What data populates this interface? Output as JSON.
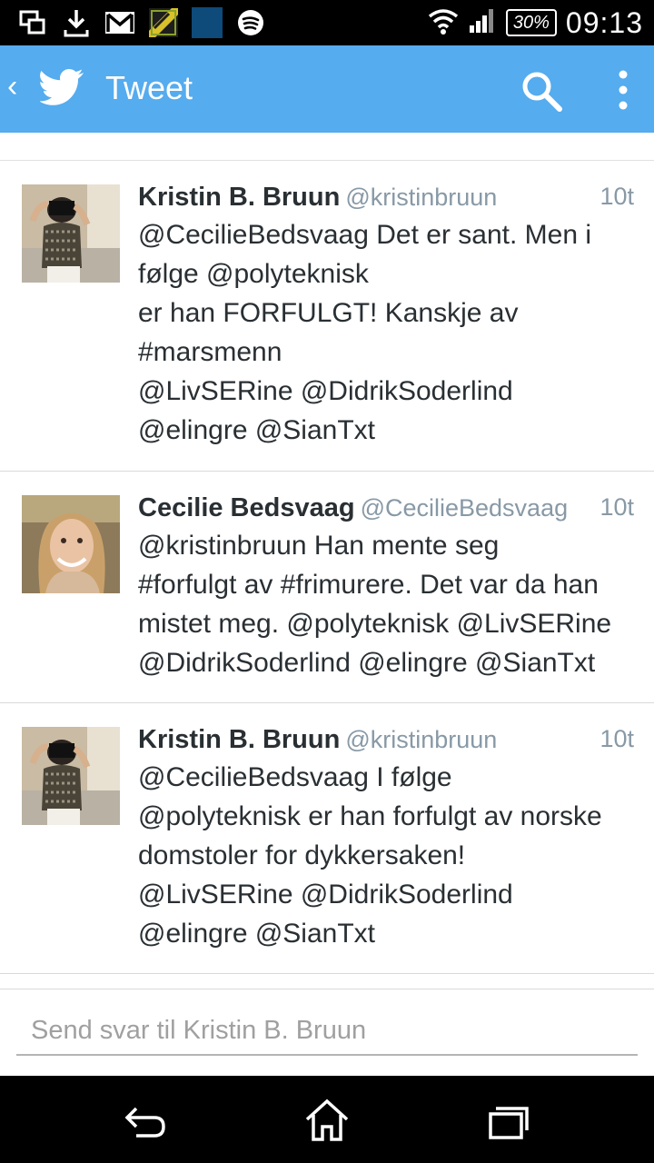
{
  "status_bar": {
    "left_icons": [
      "screen-cast-icon",
      "download-icon",
      "gmail-icon",
      "game-app-icon",
      "xperia-lounge-icon",
      "spotify-icon"
    ],
    "xperia_label": "XPERIA Lounge",
    "right_icons": [
      "wifi-icon",
      "signal-icon"
    ],
    "battery": "30%",
    "time": "09:13"
  },
  "action_bar": {
    "title": "Tweet",
    "color": "#55acee"
  },
  "tweets": [
    {
      "name": "Kristin B. Bruun",
      "handle": "@kristinbruun",
      "time": "10t",
      "lines": [
        "@CecilieBedsvaag Det er sant. Men i",
        "følge @polyteknisk",
        "er han FORFULGT! Kanskje av",
        "#marsmenn",
        "@LivSERine @DidrikSoderlind",
        "@elingre @SianTxt"
      ]
    },
    {
      "name": "Cecilie Bedsvaag",
      "handle": "@CecilieBedsvaag",
      "time": "10t",
      "lines": [
        "@kristinbruun Han mente seg",
        "#forfulgt av #frimurere. Det var da han",
        "mistet meg. @polyteknisk @LivSERine",
        "@DidrikSoderlind @elingre @SianTxt"
      ]
    },
    {
      "name": "Kristin B. Bruun",
      "handle": "@kristinbruun",
      "time": "10t",
      "lines": [
        "@CecilieBedsvaag I følge",
        "@polyteknisk er han forfulgt av norske",
        "domstoler for dykkersaken!",
        "@LivSERine @DidrikSoderlind",
        "@elingre @SianTxt"
      ]
    }
  ],
  "reply": {
    "placeholder": "Send svar til Kristin B. Bruun"
  },
  "nav_bar": {
    "icons": [
      "back-icon",
      "home-icon",
      "recent-apps-icon"
    ]
  }
}
